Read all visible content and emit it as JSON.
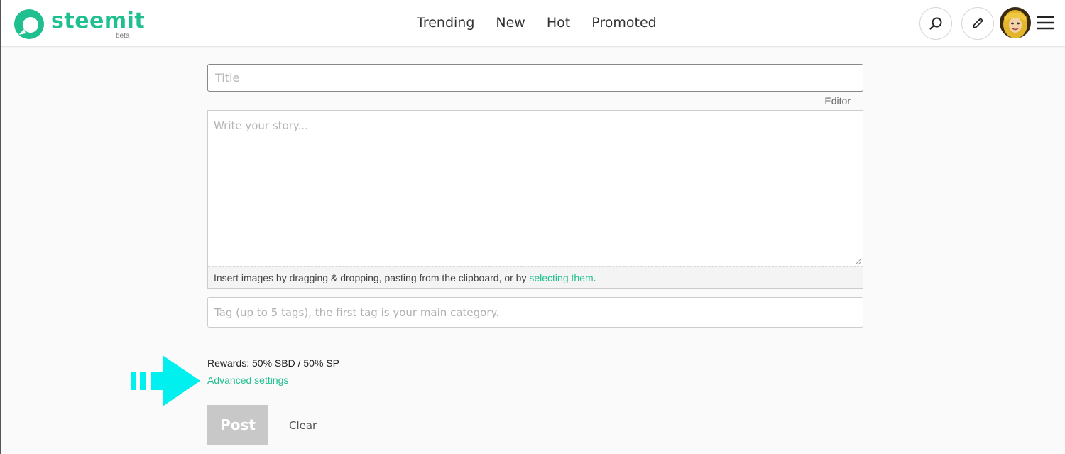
{
  "header": {
    "logo_text": "steemit",
    "logo_badge": "beta",
    "nav": [
      "Trending",
      "New",
      "Hot",
      "Promoted"
    ],
    "icons": [
      "search-icon",
      "pencil-icon",
      "avatar",
      "hamburger-menu-icon"
    ]
  },
  "form": {
    "title_placeholder": "Title",
    "editor_label": "Editor",
    "story_placeholder": "Write your story...",
    "drop_hint_text": "Insert images by dragging & dropping, pasting from the clipboard, or by ",
    "drop_hint_link": "selecting them",
    "drop_hint_end": ".",
    "tags_placeholder": "Tag (up to 5 tags), the first tag is your main category.",
    "rewards_text": "Rewards: 50% SBD / 50% SP",
    "advanced_link": "Advanced settings",
    "post_label": "Post",
    "clear_label": "Clear"
  },
  "colors": {
    "brand": "#1fbf8f",
    "annotation_arrow": "#00f0f0",
    "post_disabled": "#c8c8c8"
  }
}
